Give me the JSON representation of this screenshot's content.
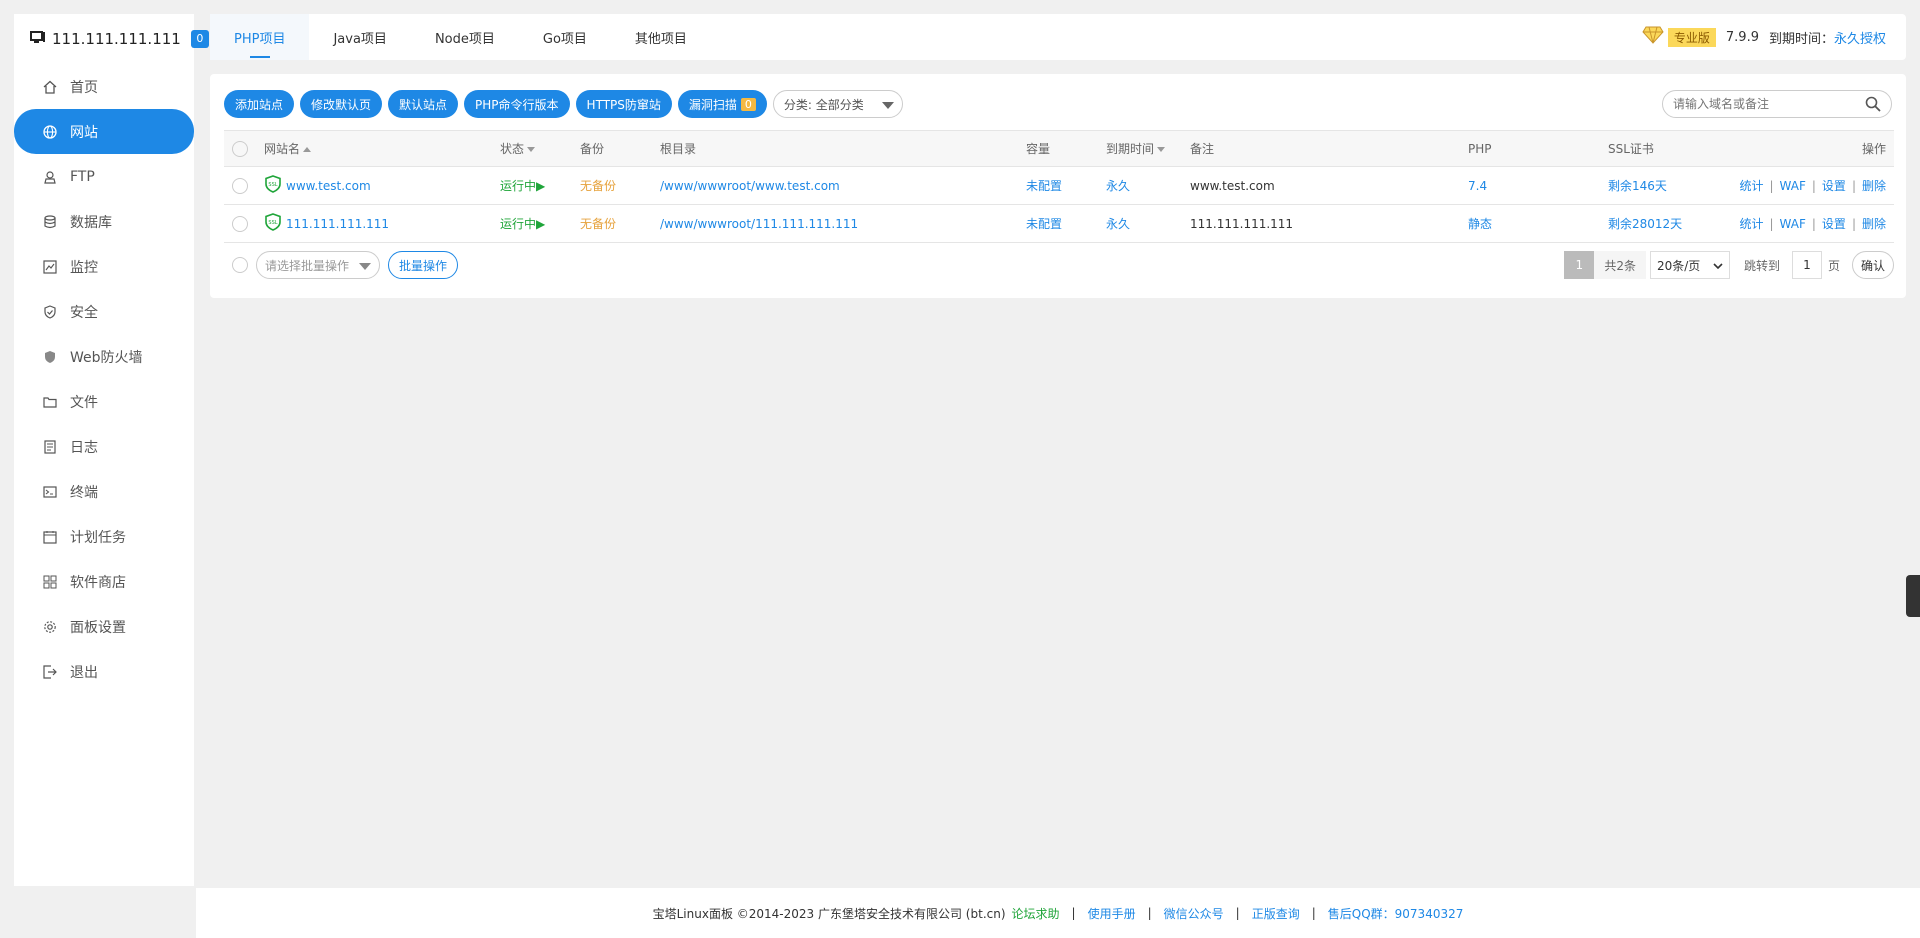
{
  "sidebar": {
    "host": "111.111.111.111",
    "badge": "0",
    "items": [
      {
        "label": "首页",
        "icon": "home-icon"
      },
      {
        "label": "网站",
        "icon": "globe-icon",
        "active": true
      },
      {
        "label": "FTP",
        "icon": "ftp-icon"
      },
      {
        "label": "数据库",
        "icon": "database-icon"
      },
      {
        "label": "监控",
        "icon": "monitor-icon"
      },
      {
        "label": "安全",
        "icon": "shield-icon"
      },
      {
        "label": "Web防火墙",
        "icon": "firewall-icon"
      },
      {
        "label": "文件",
        "icon": "folder-icon"
      },
      {
        "label": "日志",
        "icon": "log-icon"
      },
      {
        "label": "终端",
        "icon": "terminal-icon"
      },
      {
        "label": "计划任务",
        "icon": "calendar-icon"
      },
      {
        "label": "软件商店",
        "icon": "apps-icon"
      },
      {
        "label": "面板设置",
        "icon": "gear-icon"
      },
      {
        "label": "退出",
        "icon": "logout-icon"
      }
    ]
  },
  "tabs": [
    "PHP项目",
    "Java项目",
    "Node项目",
    "Go项目",
    "其他项目"
  ],
  "topright": {
    "edition": "专业版",
    "version": "7.9.9",
    "expire_label": "到期时间：",
    "expire_value": "永久授权"
  },
  "toolbar": {
    "buttons": [
      "添加站点",
      "修改默认页",
      "默认站点",
      "PHP命令行版本",
      "HTTPS防窜站"
    ],
    "scan_label": "漏洞扫描",
    "scan_count": "0",
    "category": "分类: 全部分类",
    "search_placeholder": "请输入域名或备注"
  },
  "table": {
    "headers": {
      "name": "网站名",
      "status": "状态",
      "backup": "备份",
      "root": "根目录",
      "capacity": "容量",
      "expire": "到期时间",
      "remark": "备注",
      "php": "PHP",
      "ssl": "SSL证书",
      "ops": "操作"
    },
    "rows": [
      {
        "name": "www.test.com",
        "status": "运行中▶",
        "backup": "无备份",
        "root": "/www/wwwroot/www.test.com",
        "capacity": "未配置",
        "expire": "永久",
        "remark": "www.test.com",
        "php": "7.4",
        "ssl": "剩余146天"
      },
      {
        "name": "111.111.111.111",
        "status": "运行中▶",
        "backup": "无备份",
        "root": "/www/wwwroot/111.111.111.111",
        "capacity": "未配置",
        "expire": "永久",
        "remark": "111.111.111.111",
        "php": "静态",
        "ssl": "剩余28012天"
      }
    ],
    "ops": [
      "统计",
      "WAF",
      "设置",
      "删除"
    ]
  },
  "bottom": {
    "batch_placeholder": "请选择批量操作",
    "batch_button": "批量操作",
    "current_page": "1",
    "total": "共2条",
    "per_page": "20条/页",
    "jump_label": "跳转到",
    "jump_value": "1",
    "page_unit": "页",
    "confirm": "确认"
  },
  "footer": {
    "copyright": "宝塔Linux面板 ©2014-2023 广东堡塔安全技术有限公司 (bt.cn)",
    "forum": "论坛求助",
    "manual": "使用手册",
    "wechat": "微信公众号",
    "genuine": "正版查询",
    "qq": "售后QQ群：907340327"
  },
  "colors": {
    "accent": "#1e88e5",
    "running": "#20a53a",
    "no_backup": "#e6a23c"
  }
}
